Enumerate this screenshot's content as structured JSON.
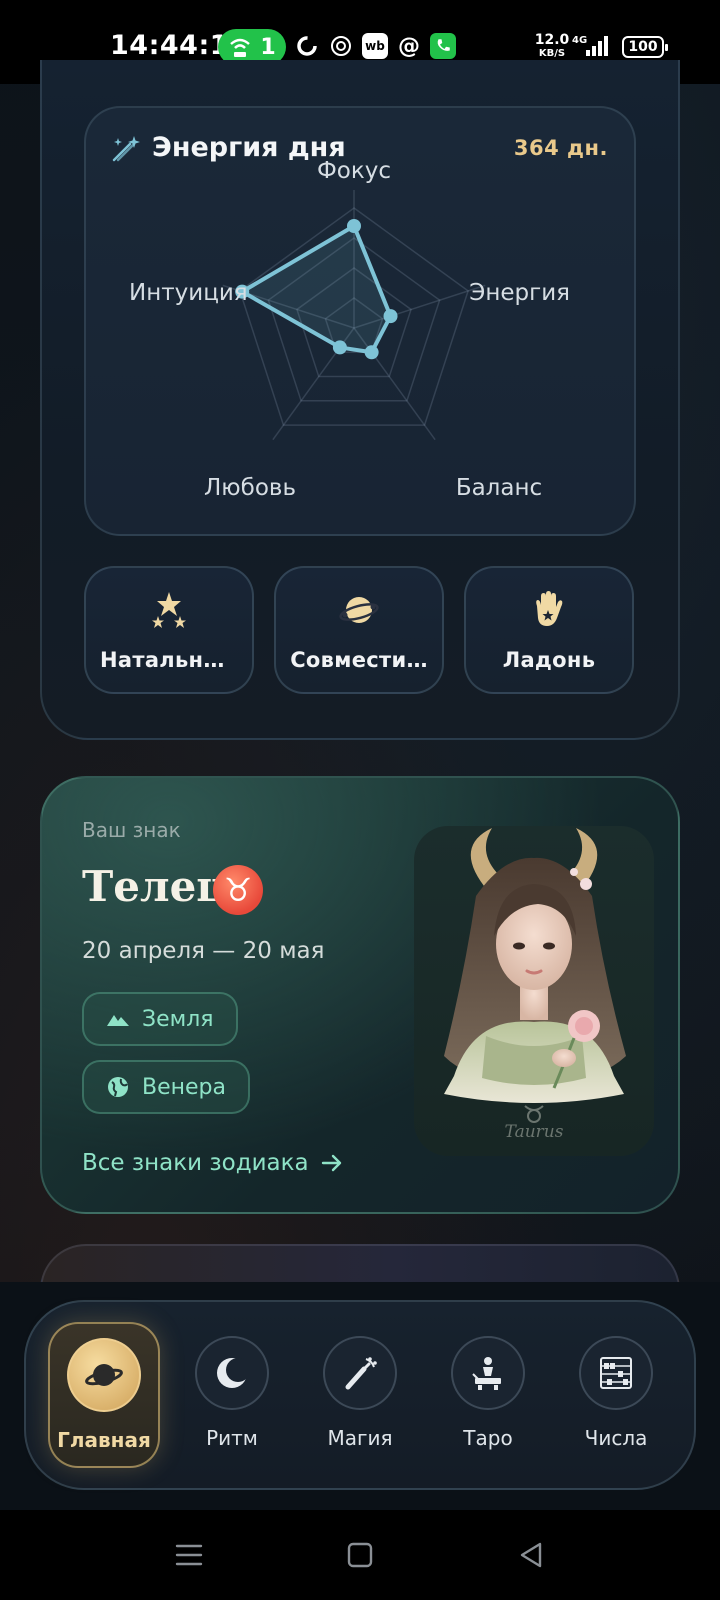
{
  "status_bar": {
    "time": "14:44:10",
    "hotspot_count": "1",
    "wb_label": "wb",
    "at_symbol": "@",
    "net_speed": "12.0",
    "net_unit": "KB/S",
    "battery": "100"
  },
  "energy": {
    "title": "Энергия дня",
    "days": "364 дн.",
    "axes": [
      {
        "label": "Фокус",
        "value": 0.85
      },
      {
        "label": "Энергия",
        "value": 0.32
      },
      {
        "label": "Баланс",
        "value": 0.25
      },
      {
        "label": "Любовь",
        "value": 0.2
      },
      {
        "label": "Интуиция",
        "value": 0.98
      }
    ]
  },
  "quick_actions": [
    {
      "label": "Натальна…",
      "icon": "stars-icon"
    },
    {
      "label": "Совмести…",
      "icon": "planet-icon"
    },
    {
      "label": "Ладонь",
      "icon": "palm-icon"
    }
  ],
  "zodiac": {
    "caption": "Ваш знак",
    "name": "Телец",
    "symbol": "♉",
    "dates": "20 апреля — 20 мая",
    "element": "Земля",
    "planet": "Венера",
    "all_signs_link": "Все знаки зодиака",
    "image_caption": "Taurus"
  },
  "bottom_nav": [
    {
      "label": "Главная",
      "icon": "planet-icon",
      "active": true
    },
    {
      "label": "Ритм",
      "icon": "moon-icon",
      "active": false
    },
    {
      "label": "Магия",
      "icon": "wand-icon",
      "active": false
    },
    {
      "label": "Таро",
      "icon": "tarot-icon",
      "active": false
    },
    {
      "label": "Числа",
      "icon": "abacus-icon",
      "active": false
    }
  ],
  "colors": {
    "accent_gold": "#e9c98b",
    "accent_teal": "#8fe3c7",
    "radar_line": "#7ec3d6"
  }
}
